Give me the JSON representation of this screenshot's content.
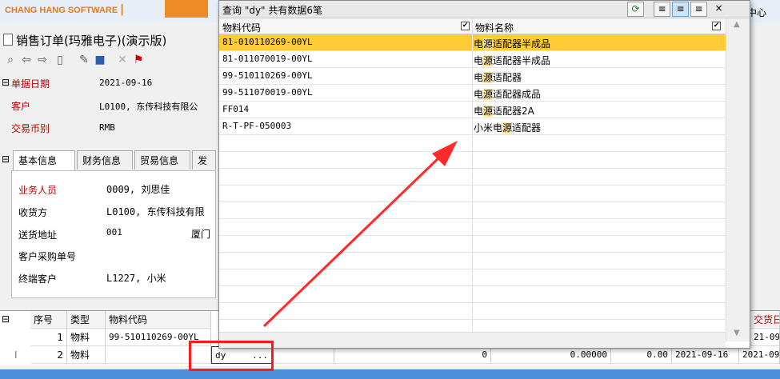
{
  "brand": {
    "name": "CHANG HANG SOFTWARE",
    "sep": "|",
    "center_link": "中心"
  },
  "document": {
    "title": "销售订单(玛雅电子)(演示版)"
  },
  "header_fields": [
    {
      "label": "单据日期",
      "value": "2021-09-16"
    },
    {
      "label": "客户",
      "value": "L0100, 东传科技有限公"
    },
    {
      "label": "交易币别",
      "value": "RMB"
    }
  ],
  "tabs": [
    "基本信息",
    "财务信息",
    "贸易信息",
    "发"
  ],
  "basic_fields": [
    {
      "label": "业务人员",
      "value": "0009, 刘思佳",
      "red": true
    },
    {
      "label": "收货方",
      "value": "L0100, 东传科技有限",
      "red": false
    },
    {
      "label": "送货地址",
      "value": "001",
      "extra": "厦门",
      "red": false
    },
    {
      "label": "客户采购单号",
      "value": "",
      "red": false
    },
    {
      "label": "终端客户",
      "value": "L1227, 小米",
      "red": false
    }
  ],
  "grid": {
    "headers": [
      "序号",
      "类型",
      "物料代码"
    ],
    "right_header": "交货日期",
    "rows": [
      {
        "seq": "1",
        "type": "物料",
        "code": "99-510110269-00YL",
        "tail": "21-09-"
      },
      {
        "seq": "2",
        "type": "物料",
        "code": "dy",
        "qty": "0",
        "price": "0.00000",
        "amount": "0.00",
        "date1": "2021-09-16",
        "date2": "2021-09-"
      }
    ],
    "cursor_mark": "I",
    "ellipsis": "..."
  },
  "popup": {
    "title": "查询 \"dy\" 共有数据6笔",
    "col_code": "物料代码",
    "col_name": "物料名称",
    "check": "✔",
    "rows": [
      {
        "code": "81-010110269-00YL",
        "pre": "电",
        "hl": "源",
        "post": "适配器半成品",
        "selected": true
      },
      {
        "code": "81-011070019-00YL",
        "pre": "电",
        "hl": "源",
        "post": "适配器半成品",
        "selected": false
      },
      {
        "code": "99-510110269-00YL",
        "pre": "电",
        "hl": "源",
        "post": "适配器",
        "selected": false
      },
      {
        "code": "99-511070019-00YL",
        "pre": "电",
        "hl": "源",
        "post": "适配器成品",
        "selected": false
      },
      {
        "code": "FF014",
        "pre": "电",
        "hl": "源",
        "post": "适配器2A",
        "selected": false
      },
      {
        "code": "R-T-PF-050003",
        "pre": "小米电",
        "hl": "源",
        "post": "适配器",
        "selected": false
      }
    ],
    "buttons": {
      "refresh": "⟳",
      "align_left": "≡",
      "align_center": "≡",
      "align_right": "≡",
      "close": "×"
    }
  },
  "colors": {
    "selected_row": "#ffcc33",
    "highlight": "#ffe59a",
    "red_box": "#ff1a1a",
    "arrow": "#ff2a2a",
    "required_label": "#c00000"
  }
}
